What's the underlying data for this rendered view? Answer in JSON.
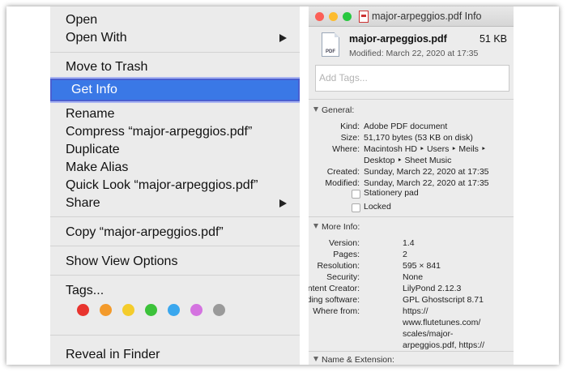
{
  "context_menu": {
    "items": {
      "open": "Open",
      "open_with": "Open With",
      "move_to_trash": "Move to Trash",
      "get_info": "Get Info",
      "rename": "Rename",
      "compress": "Compress “major-arpeggios.pdf”",
      "duplicate": "Duplicate",
      "make_alias": "Make Alias",
      "quick_look": "Quick Look “major-arpeggios.pdf”",
      "share": "Share",
      "copy": "Copy “major-arpeggios.pdf”",
      "show_view_options": "Show View Options",
      "tags": "Tags...",
      "reveal_in_finder": "Reveal in Finder"
    },
    "highlight_color": "#3a78e6",
    "tag_colors": [
      "#e8342e",
      "#f39a2b",
      "#f4cc2c",
      "#3cc23a",
      "#3aa7ee",
      "#d473e0",
      "#9a9a9a"
    ]
  },
  "info_window": {
    "title": "major-arpeggios.pdf Info",
    "traffic_lights": [
      "#fc5f57",
      "#fdbc2e",
      "#28c840"
    ],
    "file_icon_label": "PDF",
    "file_name": "major-arpeggios.pdf",
    "file_size": "51 KB",
    "modified_summary": "Modified: March 22, 2020 at 17:35",
    "tags_placeholder": "Add Tags...",
    "general": {
      "heading": "General:",
      "kind_label": "Kind:",
      "kind": "Adobe PDF document",
      "size_label": "Size:",
      "size": "51,170 bytes (53 KB on disk)",
      "where_label": "Where:",
      "where_line1": "Macintosh HD ‣ Users ‣ Meils ‣",
      "where_line2": "Desktop ‣ Sheet Music",
      "created_label": "Created:",
      "created": "Sunday, March 22, 2020 at 17:35",
      "modified_label": "Modified:",
      "modified": "Sunday, March 22, 2020 at 17:35",
      "stationery_pad": "Stationery pad",
      "locked": "Locked"
    },
    "more_info": {
      "heading": "More Info:",
      "version_label": "Version:",
      "version": "1.4",
      "pages_label": "Pages:",
      "pages": "2",
      "resolution_label": "Resolution:",
      "resolution": "595 × 841",
      "security_label": "Security:",
      "security": "None",
      "content_creator_label": "Content Creator:",
      "content_creator": "LilyPond 2.12.3",
      "encoding_software_label": "Encoding software:",
      "encoding_software": "GPL Ghostscript 8.71",
      "where_from_label": "Where from:",
      "where_from_1": "https://",
      "where_from_2": "www.flutetunes.com/",
      "where_from_3": "scales/major-",
      "where_from_4": "arpeggios.pdf, https://"
    },
    "name_extension_heading": "Name & Extension:"
  }
}
